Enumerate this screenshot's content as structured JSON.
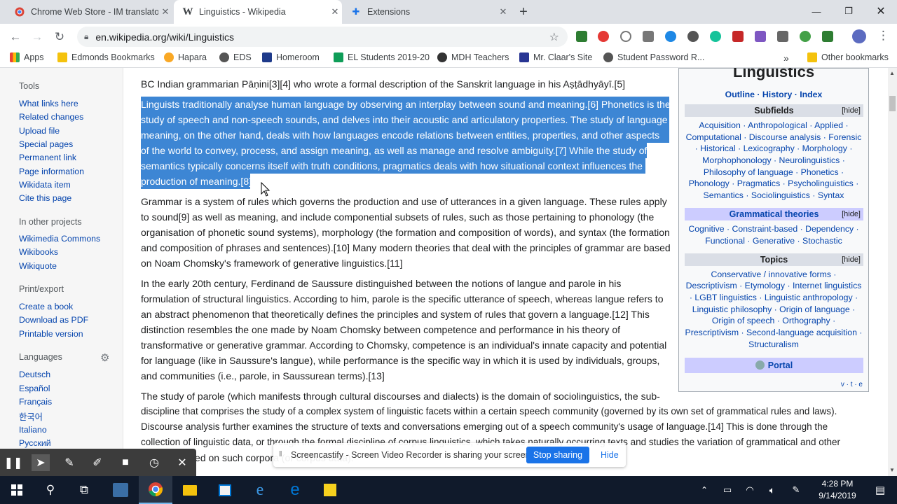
{
  "tabs": [
    {
      "title": "Chrome Web Store - IM translator",
      "icon": "chrome-web-store-icon",
      "active": false
    },
    {
      "title": "Linguistics - Wikipedia",
      "icon": "wikipedia-icon",
      "active": true
    },
    {
      "title": "Extensions",
      "icon": "puzzle-icon",
      "active": false
    }
  ],
  "url": "en.wikipedia.org/wiki/Linguistics",
  "bookmarks": [
    "Apps",
    "Edmonds Bookmarks",
    "Hapara",
    "EDS",
    "Homeroom",
    "EL Students 2019-20",
    "MDH Teachers",
    "Mr. Claar's Site",
    "Student Password R...",
    "Other bookmarks"
  ],
  "sidebar": {
    "tools_heading": "Tools",
    "tools": [
      "What links here",
      "Related changes",
      "Upload file",
      "Special pages",
      "Permanent link",
      "Page information",
      "Wikidata item",
      "Cite this page"
    ],
    "projects_heading": "In other projects",
    "projects": [
      "Wikimedia Commons",
      "Wikibooks",
      "Wikiquote"
    ],
    "print_heading": "Print/export",
    "print": [
      "Create a book",
      "Download as PDF",
      "Printable version"
    ],
    "languages_heading": "Languages",
    "languages": [
      "Deutsch",
      "Español",
      "Français",
      "한국어",
      "Italiano",
      "Русский"
    ]
  },
  "article": {
    "p0": [
      "BC Indian grammarian Pāṇini[3][4] who wrote a formal description of the Sanskrit language in his Aṣṭādhyāyī.[5]"
    ],
    "hl": [
      "Linguists traditionally analyse human language by observing an interplay between sound and meaning.[6] Phonetics is the",
      "study of speech and non-speech sounds, and delves into their acoustic and articulatory properties. The study of language",
      "meaning, on the other hand, deals with how languages encode relations between entities, properties, and other aspects",
      "of the world to convey, process, and assign meaning, as well as manage and resolve ambiguity.[7] While the study of",
      "semantics typically concerns itself with truth conditions, pragmatics deals with how situational context influences the",
      "production of meaning.[8]"
    ],
    "p2": [
      "Grammar is a system of rules which governs the production and use of utterances in a given language. These rules apply",
      "to sound[9] as well as meaning, and include componential subsets of rules, such as those pertaining to phonology (the",
      "organisation of phonetic sound systems), morphology (the formation and composition of words), and syntax (the formation",
      "and composition of phrases and sentences).[10] Many modern theories that deal with the principles of grammar are based",
      "on Noam Chomsky's framework of generative linguistics.[11]"
    ],
    "p3": [
      "In the early 20th century, Ferdinand de Saussure distinguished between the notions of langue and parole in his",
      "formulation of structural linguistics. According to him, parole is the specific utterance of speech, whereas langue refers to",
      "an abstract phenomenon that theoretically defines the principles and system of rules that govern a language.[12] This",
      "distinction resembles the one made by Noam Chomsky between competence and performance in his theory of",
      "transformative or generative grammar. According to Chomsky, competence is an individual's innate capacity and potential",
      "for language (like in Saussure's langue), while performance is the specific way in which it is used by individuals, groups,",
      "and communities (i.e., parole, in Saussurean terms).[13]"
    ],
    "p4": [
      "The study of parole (which manifests through cultural discourses and dialects) is the domain of sociolinguistics, the sub-",
      "discipline that comprises the study of a complex system of linguistic facets within a certain speech community (governed by its own set of grammatical rules and laws).",
      "Discourse analysis further examines the structure of texts and conversations emerging out of a speech community's usage of language.[14] This is done through the",
      "collection of linguistic data, or through the formal discipline of corpus linguistics, which takes naturally occurring texts and studies the variation of grammatical and other",
      "features based on such corpora (or corpus data)."
    ]
  },
  "navbox": {
    "title": "Linguistics",
    "top_links": "Outline · History · Index",
    "hide_label": "[hide]",
    "sections": [
      {
        "heading": "Subfields",
        "lines": [
          "Acquisition · Anthropological · Applied ·",
          "Computational · Discourse analysis · Forensic",
          "· Historical · Lexicography · Morphology ·",
          "Morphophonology · Neurolinguistics ·",
          "Philosophy of language · Phonetics ·",
          "Phonology · Pragmatics · Psycholinguistics ·",
          "Semantics · Sociolinguistics · Syntax"
        ]
      },
      {
        "heading": "Grammatical theories",
        "lines": [
          "Cognitive · Constraint-based · Dependency ·",
          "Functional · Generative · Stochastic"
        ]
      },
      {
        "heading": "Topics",
        "lines": [
          "Conservative / innovative forms ·",
          "Descriptivism · Etymology · Internet linguistics",
          "· LGBT linguistics · Linguistic anthropology ·",
          "Linguistic philosophy · Origin of language ·",
          "Origin of speech · Orthography ·",
          "Prescriptivism · Second-language acquisition ·",
          "Structuralism"
        ]
      }
    ],
    "portal": "Portal",
    "vte": "v · t · e"
  },
  "screencastify": {
    "message": "Screencastify - Screen Video Recorder is sharing your screen.",
    "stop": "Stop sharing",
    "hide": "Hide"
  },
  "clock": {
    "time": "4:28 PM",
    "date": "9/14/2019"
  },
  "colors": {
    "highlight": "#3d86d4",
    "link": "#0645ad",
    "taskbar": "#101a2b"
  }
}
